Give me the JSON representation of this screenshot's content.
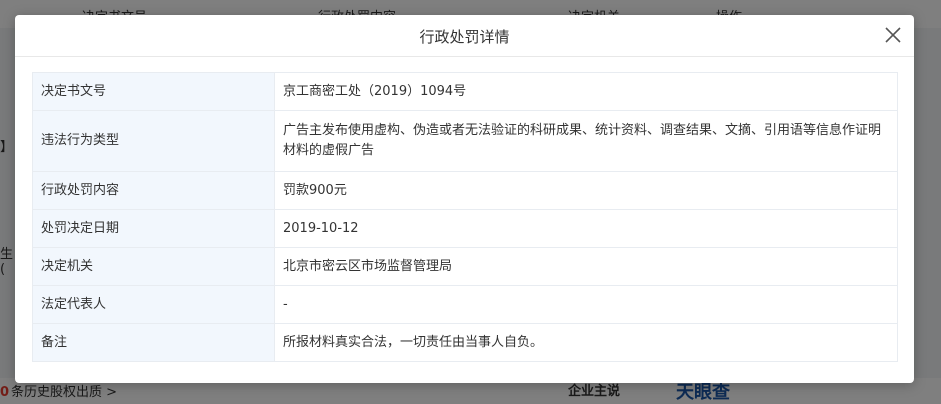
{
  "background": {
    "columns": [
      "决定书文号",
      "行政处罚内容",
      "决定机关",
      "操作"
    ],
    "left_marks": [
      "】",
      "生",
      "("
    ],
    "footer": {
      "count": "0",
      "text": "条历史股权出质 >",
      "brand1": "企业主说",
      "brand2": "天眼查"
    }
  },
  "modal": {
    "title": "行政处罚详情",
    "rows": [
      {
        "label": "决定书文号",
        "value": "京工商密工处（2019）1094号"
      },
      {
        "label": "违法行为类型",
        "value": "广告主发布使用虚构、伪造或者无法验证的科研成果、统计资料、调查结果、文摘、引用语等信息作证明材料的虚假广告"
      },
      {
        "label": "行政处罚内容",
        "value": "罚款900元"
      },
      {
        "label": "处罚决定日期",
        "value": "2019-10-12"
      },
      {
        "label": "决定机关",
        "value": "北京市密云区市场监督管理局"
      },
      {
        "label": "法定代表人",
        "value": "-"
      },
      {
        "label": "备注",
        "value": "所报材料真实合法，一切责任由当事人自负。"
      }
    ]
  },
  "colors": {
    "label_bg": "#f2f7fd",
    "border": "#e8ecf1",
    "text": "#333333",
    "accent_red": "#e63b2e"
  }
}
